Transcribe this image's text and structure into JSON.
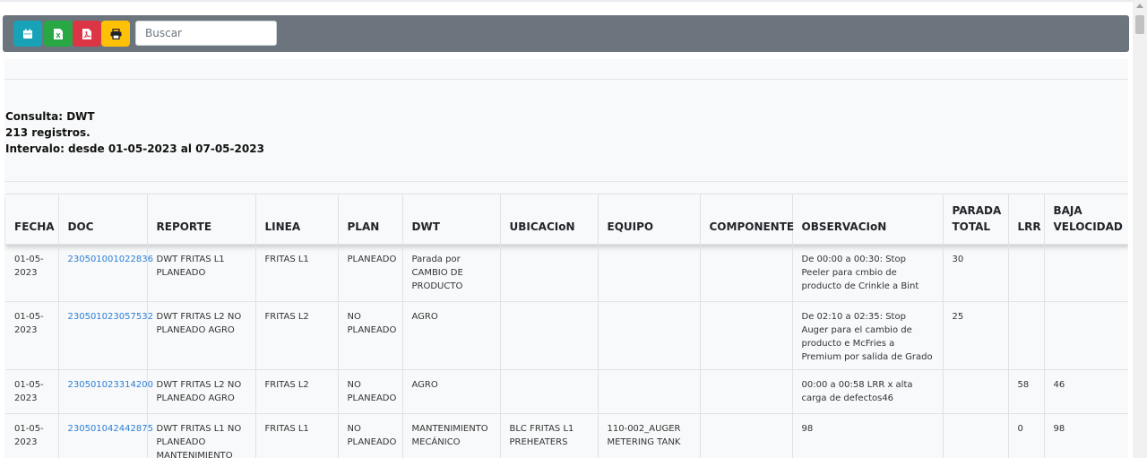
{
  "toolbar": {
    "buttons": [
      {
        "icon": "calendar-icon",
        "color": "#17a2b8"
      },
      {
        "icon": "excel-icon",
        "color": "#28a745"
      },
      {
        "icon": "pdf-icon",
        "color": "#dc3545"
      },
      {
        "icon": "print-icon",
        "color": "#ffc107"
      }
    ],
    "search_placeholder": "Buscar",
    "search_value": ""
  },
  "info": {
    "consulta": "Consulta: DWT",
    "registros": "213 registros.",
    "intervalo": "Intervalo: desde 01-05-2023 al 07-05-2023"
  },
  "table": {
    "headers": [
      "FECHA",
      "DOC",
      "REPORTE",
      "LINEA",
      "PLAN",
      "DWT",
      "UBICACIoN",
      "EQUIPO",
      "COMPONENTE",
      "OBSERVACIoN",
      "PARADA TOTAL",
      "LRR",
      "BAJA VELOCIDAD"
    ],
    "rows": [
      [
        "01-05-2023",
        "230501001022836",
        "DWT FRITAS L1 PLANEADO",
        "FRITAS L1",
        "PLANEADO",
        "Parada por CAMBIO DE PRODUCTO",
        "",
        "",
        "",
        "De 00:00 a 00:30: Stop Peeler para cmbio de producto de Crinkle a Bint",
        "30",
        "",
        ""
      ],
      [
        "01-05-2023",
        "230501023057532",
        "DWT FRITAS L2 NO PLANEADO AGRO",
        "FRITAS L2",
        "NO PLANEADO",
        "AGRO",
        "",
        "",
        "",
        "De 02:10 a 02:35: Stop Auger para el cambio de producto e McFries a Premium por salida de Grado",
        "25",
        "",
        ""
      ],
      [
        "01-05-2023",
        "230501023314200",
        "DWT FRITAS L2 NO PLANEADO AGRO",
        "FRITAS L2",
        "NO PLANEADO",
        "AGRO",
        "",
        "",
        "",
        "00:00 a 00:58 LRR x alta carga de defectos46",
        "",
        "58",
        "46"
      ],
      [
        "01-05-2023",
        "230501042442875",
        "DWT FRITAS L1 NO PLANEADO MANTENIMIENTO",
        "FRITAS L1",
        "NO PLANEADO",
        "MANTENIMIENTO MECÁNICO",
        "BLC FRITAS L1 PREHEATERS",
        "110-002_AUGER METERING TANK",
        "",
        "98",
        "",
        "0",
        "98"
      ]
    ]
  }
}
